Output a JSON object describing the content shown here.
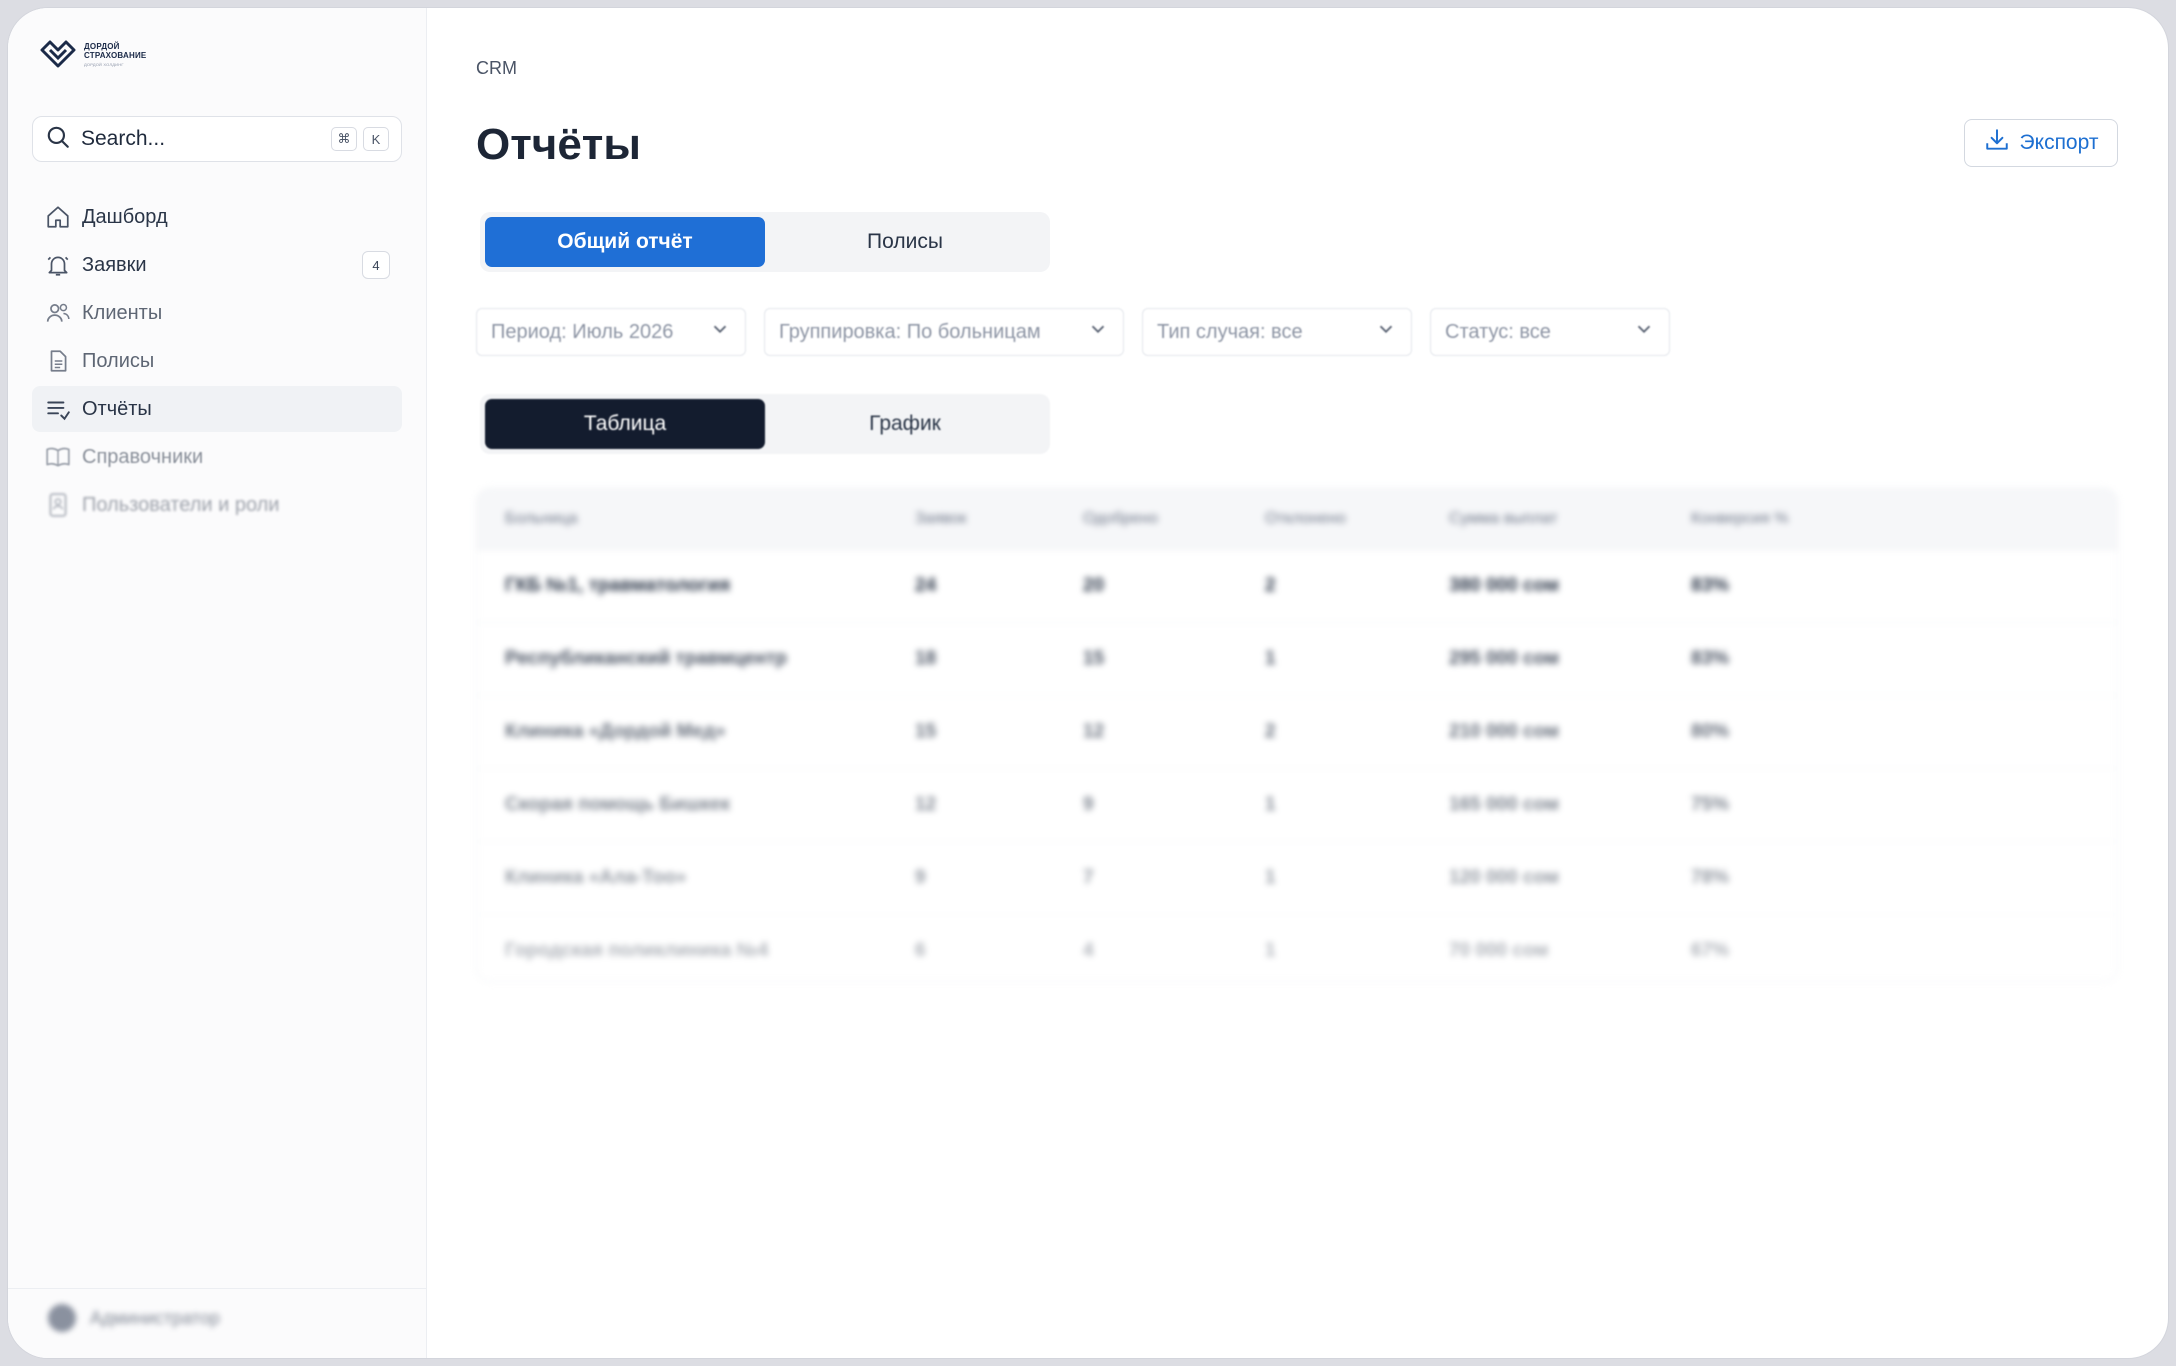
{
  "brand": {
    "line1": "ДОРДОЙ",
    "line2": "СТРАХОВАНИЕ",
    "line3": "ДОРДОЙ ХОЛДИНГ"
  },
  "search": {
    "placeholder": "Search...",
    "key1": "⌘",
    "key2": "K"
  },
  "nav": [
    {
      "label": "Дашборд",
      "icon": "home-icon"
    },
    {
      "label": "Заявки",
      "icon": "bell-icon",
      "badge": "4"
    },
    {
      "label": "Клиенты",
      "icon": "users-icon"
    },
    {
      "label": "Полисы",
      "icon": "document-icon"
    },
    {
      "label": "Отчёты",
      "icon": "report-list-icon",
      "active": true
    },
    {
      "label": "Справочники",
      "icon": "book-icon"
    },
    {
      "label": "Пользователи и роли",
      "icon": "user-card-icon"
    }
  ],
  "user": {
    "name": "Администратор"
  },
  "breadcrumb": "CRM",
  "page_title": "Отчёты",
  "export_label": "Экспорт",
  "report_tabs": [
    "Общий отчёт",
    "Полисы"
  ],
  "filters": [
    "Период: Июль 2026",
    "Группировка: По больницам",
    "Тип случая: все",
    "Статус: все"
  ],
  "view_tabs": [
    "Таблица",
    "График"
  ],
  "table": {
    "columns": [
      "Больница",
      "Заявок",
      "Одобрено",
      "Отклонено",
      "Сумма выплат",
      "Конверсия %"
    ],
    "rows": [
      [
        "ГКБ №1, травматология",
        "24",
        "20",
        "2",
        "380 000 сом",
        "83%"
      ],
      [
        "Республиканский травмцентр",
        "18",
        "15",
        "1",
        "295 000 сом",
        "83%"
      ],
      [
        "Клиника «Дордой Мед»",
        "15",
        "12",
        "2",
        "210 000 сом",
        "80%"
      ],
      [
        "Скорая помощь Бишкек",
        "12",
        "9",
        "1",
        "165 000 сом",
        "75%"
      ],
      [
        "Клиника «Ала-Тоо»",
        "9",
        "7",
        "1",
        "120 000 сом",
        "78%"
      ],
      [
        "Городская поликлиника №4",
        "6",
        "4",
        "1",
        "70 000 сом",
        "67%"
      ]
    ]
  },
  "colors": {
    "accent": "#1f6fd6",
    "dark": "#131c2e"
  }
}
